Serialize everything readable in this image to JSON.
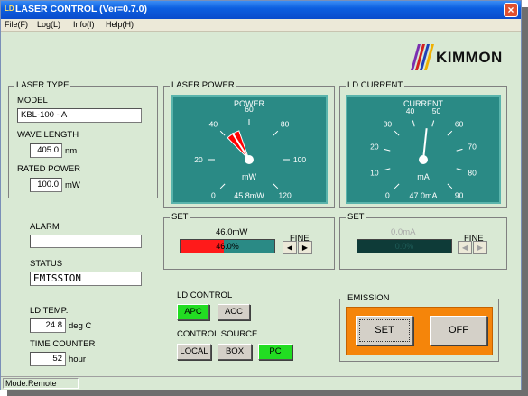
{
  "window": {
    "title": "LASER CONTROL (Ver=0.7.0)",
    "icon_text": "LD",
    "close_glyph": "×"
  },
  "menu": [
    "File(F)",
    "Log(L)",
    "Info(I)",
    "Help(H)"
  ],
  "logo": {
    "brand": "KIMMON"
  },
  "laser_type": {
    "title": "LASER TYPE",
    "model_label": "MODEL",
    "model_value": "KBL-100 - A",
    "wavelength_label": "WAVE LENGTH",
    "wavelength_value": "405.0",
    "wavelength_unit": "nm",
    "rated_power_label": "RATED POWER",
    "rated_power_value": "100.0",
    "rated_power_unit": "mW"
  },
  "alarm": {
    "label": "ALARM",
    "value": ""
  },
  "status": {
    "label": "STATUS",
    "value": "EMISSION"
  },
  "ld_temp": {
    "label": "LD TEMP.",
    "value": "24.8",
    "unit": "deg C"
  },
  "time_counter": {
    "label": "TIME COUNTER",
    "value": "52",
    "unit": "hour"
  },
  "laser_power": {
    "title": "LASER POWER",
    "gauge_title": "POWER",
    "unit": "mW",
    "reading": "45.8mW",
    "value": 45.8,
    "min": 0,
    "max": 120,
    "ticks": [
      "0",
      "20",
      "40",
      "60",
      "80",
      "100",
      "120"
    ]
  },
  "ld_current": {
    "title": "LD CURRENT",
    "gauge_title": "CURRENT",
    "unit": "mA",
    "reading": "47.0mA",
    "value": 47.0,
    "min": 0,
    "max": 90,
    "ticks": [
      "0",
      "10",
      "20",
      "30",
      "40",
      "50",
      "60",
      "70",
      "80",
      "90"
    ]
  },
  "power_set": {
    "title": "SET",
    "value": "46.0mW",
    "fine_label": "FINE",
    "bar_text": "46.0%",
    "percent": 46.0
  },
  "current_set": {
    "title": "SET",
    "value": "0.0mA",
    "fine_label": "FINE",
    "bar_text": "0.0%",
    "percent": 0.0
  },
  "fine_arrows": {
    "left": "◀",
    "right": "▶"
  },
  "ld_control": {
    "title": "LD CONTROL",
    "options": [
      "APC",
      "ACC"
    ],
    "active": "APC"
  },
  "control_source": {
    "title": "CONTROL SOURCE",
    "options": [
      "LOCAL",
      "BOX",
      "PC"
    ],
    "active": "PC"
  },
  "emission": {
    "title": "EMISSION",
    "set_label": "SET",
    "off_label": "OFF"
  },
  "statusbar": {
    "mode": "Mode:Remote"
  },
  "colors": {
    "gauge_face": "#2a8a85",
    "needle_fill": "#ff0000",
    "power_bar": "#ff1a1a",
    "active_button": "#22dd22",
    "emission_panel": "#f5850a"
  }
}
